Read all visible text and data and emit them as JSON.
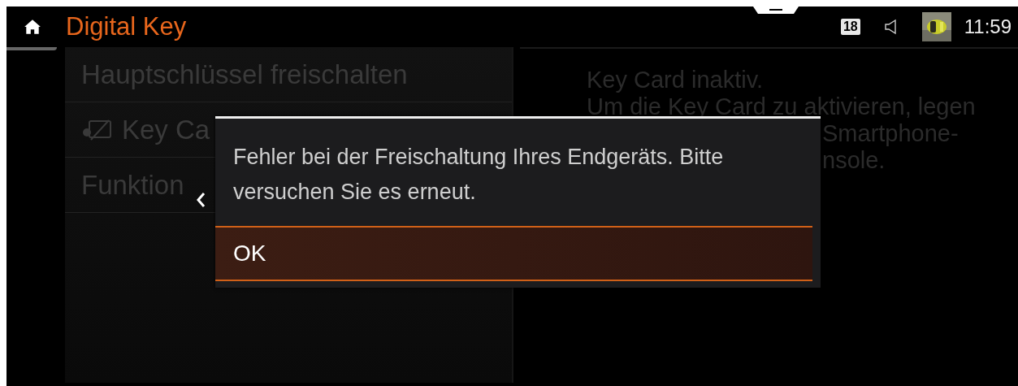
{
  "header": {
    "title": "Digital Key",
    "badge": "18",
    "time": "11:59"
  },
  "menu": {
    "items": [
      {
        "label": "Hauptschlüssel freischalten",
        "kind": "text"
      },
      {
        "label": "Key Ca",
        "kind": "icon"
      },
      {
        "label": "Funktion",
        "kind": "text"
      }
    ]
  },
  "detail": {
    "lines": [
      "Key Card inaktiv.",
      "Um die Key Card zu aktivieren, legen"
    ],
    "partly_hidden_lines": [
      "Smartphone-",
      "nsole."
    ]
  },
  "dialog": {
    "message": "Fehler bei der Freischaltung Ihres Endgeräts. Bitte versuchen Sie es erneut.",
    "buttons": [
      {
        "label": "OK",
        "selected": true
      }
    ]
  }
}
